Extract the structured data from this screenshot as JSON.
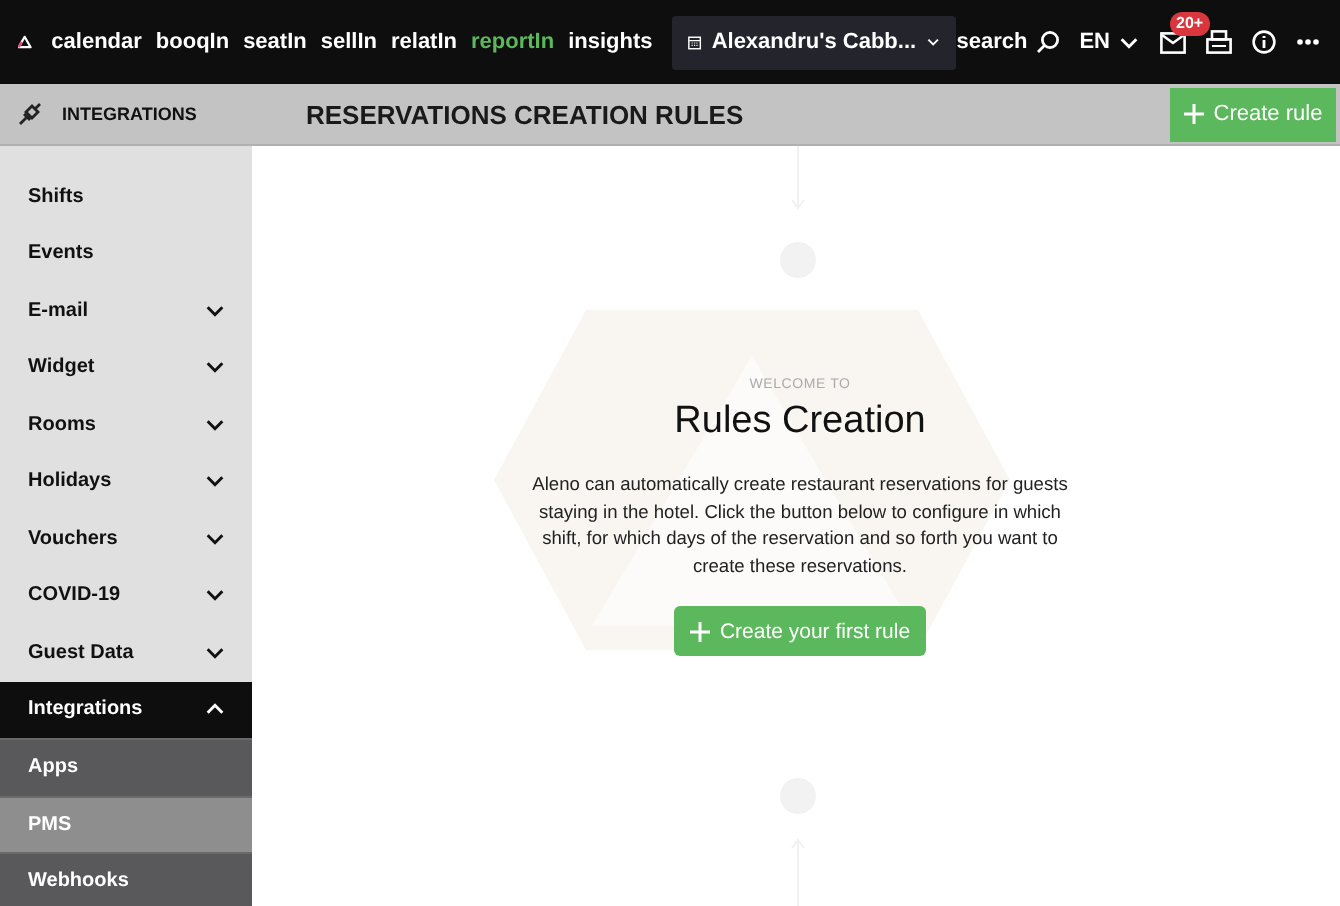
{
  "topbar": {
    "nav": [
      {
        "label": "calendar",
        "selected": false
      },
      {
        "label": "booqIn",
        "selected": false
      },
      {
        "label": "seatIn",
        "selected": false
      },
      {
        "label": "sellIn",
        "selected": false
      },
      {
        "label": "relatIn",
        "selected": false
      },
      {
        "label": "reportIn",
        "selected": true
      },
      {
        "label": "insights",
        "selected": false
      }
    ],
    "venue": "Alexandru's Cabb...",
    "search": "search",
    "language": "EN",
    "badge": "20+"
  },
  "subheader": {
    "section": "INTEGRATIONS",
    "title": "RESERVATIONS CREATION RULES",
    "button": "Create rule"
  },
  "sidebar": {
    "items": [
      {
        "label": "Shifts",
        "kind": "link"
      },
      {
        "label": "Events",
        "kind": "link"
      },
      {
        "label": "E-mail",
        "kind": "group",
        "expanded": false
      },
      {
        "label": "Widget",
        "kind": "group",
        "expanded": false
      },
      {
        "label": "Rooms",
        "kind": "group",
        "expanded": false
      },
      {
        "label": "Holidays",
        "kind": "group",
        "expanded": false
      },
      {
        "label": "Vouchers",
        "kind": "group",
        "expanded": false
      },
      {
        "label": "COVID-19",
        "kind": "group",
        "expanded": false
      },
      {
        "label": "Guest Data",
        "kind": "group",
        "expanded": false
      },
      {
        "label": "Integrations",
        "kind": "group",
        "expanded": true,
        "children": [
          {
            "label": "Apps",
            "selected": false
          },
          {
            "label": "PMS",
            "selected": true
          },
          {
            "label": "Webhooks",
            "selected": false
          }
        ]
      }
    ]
  },
  "main": {
    "eyebrow": "WELCOME TO",
    "title": "Rules Creation",
    "text": "Aleno can automatically create restaurant reservations for guests staying in the hotel. Click the button below to configure in which shift, for which days of the reservation and so forth you want to create these reservations.",
    "button": "Create your first rule"
  }
}
